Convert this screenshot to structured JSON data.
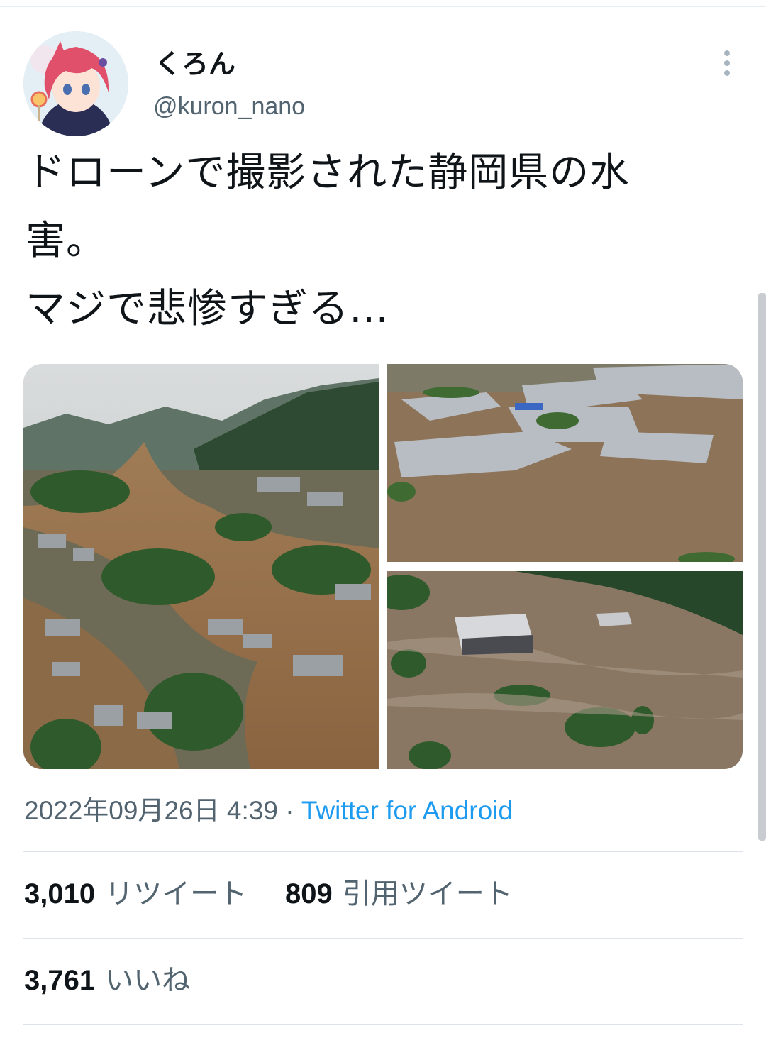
{
  "tweet": {
    "author": {
      "name": "くろん",
      "handle": "@kuron_nano"
    },
    "text": "ドローンで撮影された静岡県の水\n害。\nマジで悲惨すぎる…",
    "media": [
      {
        "alt": "flooded-town-aerial"
      },
      {
        "alt": "flooded-houses-aerial"
      },
      {
        "alt": "flooded-river-building"
      }
    ],
    "timestamp": "2022年09月26日 4:39",
    "separator": "·",
    "source": "Twitter for Android",
    "stats": {
      "retweets": {
        "count": "3,010",
        "label": "リツイート"
      },
      "quotes": {
        "count": "809",
        "label": "引用ツイート"
      },
      "likes": {
        "count": "3,761",
        "label": "いいね"
      }
    }
  },
  "colors": {
    "accent": "#1d9bf0",
    "secondary_text": "#536471",
    "primary_text": "#0f1419"
  }
}
